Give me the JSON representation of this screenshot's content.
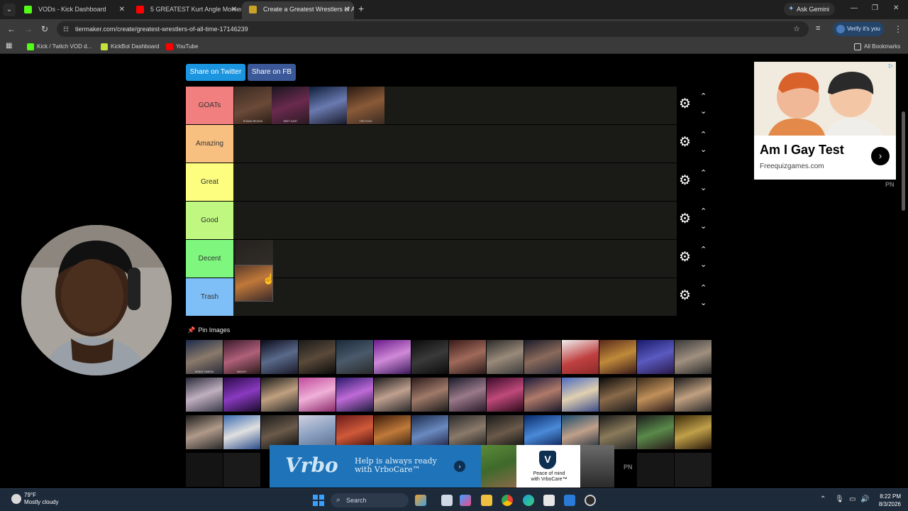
{
  "browser": {
    "tabs": [
      {
        "title": "VODs - Kick Dashboard",
        "active": false,
        "favicon_color": "#53fc18"
      },
      {
        "title": "5 GREATEST Kurt Angle Momen",
        "active": false,
        "favicon_color": "#ff0000"
      },
      {
        "title": "Create a Greatest Wrestlers of A",
        "active": true,
        "favicon_color": "#c9a227"
      }
    ],
    "ask_gemini": "Ask Gemini",
    "url": "tiermaker.com/create/greatest-wrestlers-of-all-time-17146239",
    "verify_label": "Verify it's you",
    "bookmarks": [
      "Kick / Twitch VOD d...",
      "KickBot Dashboard",
      "YouTube"
    ],
    "all_bookmarks": "All Bookmarks"
  },
  "share": {
    "twitter": "Share on Twitter",
    "fb": "Share on FB"
  },
  "tiers": [
    {
      "label": "GOATs",
      "color": "#f27f7f"
    },
    {
      "label": "Amazing",
      "color": "#f7bf80"
    },
    {
      "label": "Great",
      "color": "#fdfd80"
    },
    {
      "label": "Good",
      "color": "#bff780"
    },
    {
      "label": "Decent",
      "color": "#7ff77f"
    },
    {
      "label": "Trash",
      "color": "#7fbff7"
    }
  ],
  "goat_items": [
    "ROMAN REIGNS",
    "BRET HART",
    "",
    "THE ROCK"
  ],
  "pin_images_label": "Pin Images",
  "pool_captions_row1": [
    "KENNY OMEGA",
    "BAYLEY",
    "",
    "",
    "",
    "",
    "",
    "",
    "",
    "",
    "",
    "",
    "",
    ""
  ],
  "ad_right": {
    "title": "Am I Gay Test",
    "domain": "Freequizgames.com",
    "badge": "PN"
  },
  "ad_bottom": {
    "logo": "Vrbo",
    "message_line1": "Help is always ready",
    "message_line2": "with VrboCare™",
    "card_line1": "Peace of mind",
    "card_line2": "with VrboCare™",
    "badge": "PN"
  },
  "taskbar": {
    "weather_temp": "79°F",
    "weather_desc": "Mostly cloudy",
    "search": "Search",
    "time": "8:22 PM",
    "date": "8/3/2026"
  }
}
